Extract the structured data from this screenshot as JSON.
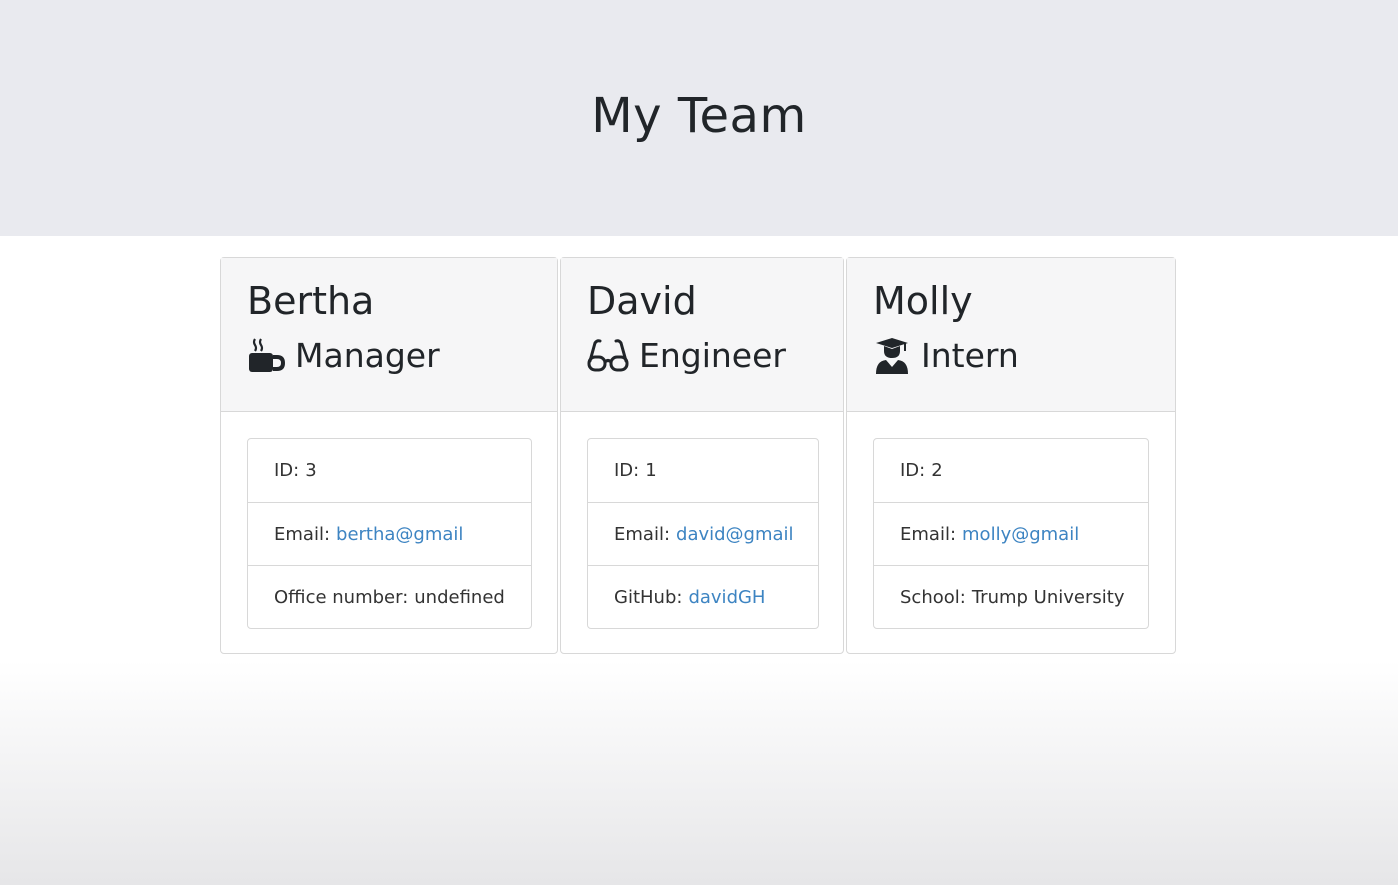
{
  "header": {
    "title": "My Team"
  },
  "employees": [
    {
      "name": "Bertha",
      "role": "Manager",
      "role_icon": "coffee-mug-icon",
      "id_label": "ID:",
      "id": "3",
      "email_label": "Email:",
      "email": "bertha@gmail",
      "extra_label": "Office number:",
      "extra_value": "undefined"
    },
    {
      "name": "David",
      "role": "Engineer",
      "role_icon": "glasses-icon",
      "id_label": "ID:",
      "id": "1",
      "email_label": "Email:",
      "email": "david@gmail",
      "extra_label": "GitHub:",
      "extra_value": "davidGH"
    },
    {
      "name": "Molly",
      "role": "Intern",
      "role_icon": "graduate-icon",
      "id_label": "ID:",
      "id": "2",
      "email_label": "Email:",
      "email": "molly@gmail",
      "extra_label": "School:",
      "extra_value": "Trump University"
    }
  ],
  "colors": {
    "link": "#3d84c2",
    "header_bg": "#e9eaef",
    "card_header_bg": "#f6f6f7"
  }
}
